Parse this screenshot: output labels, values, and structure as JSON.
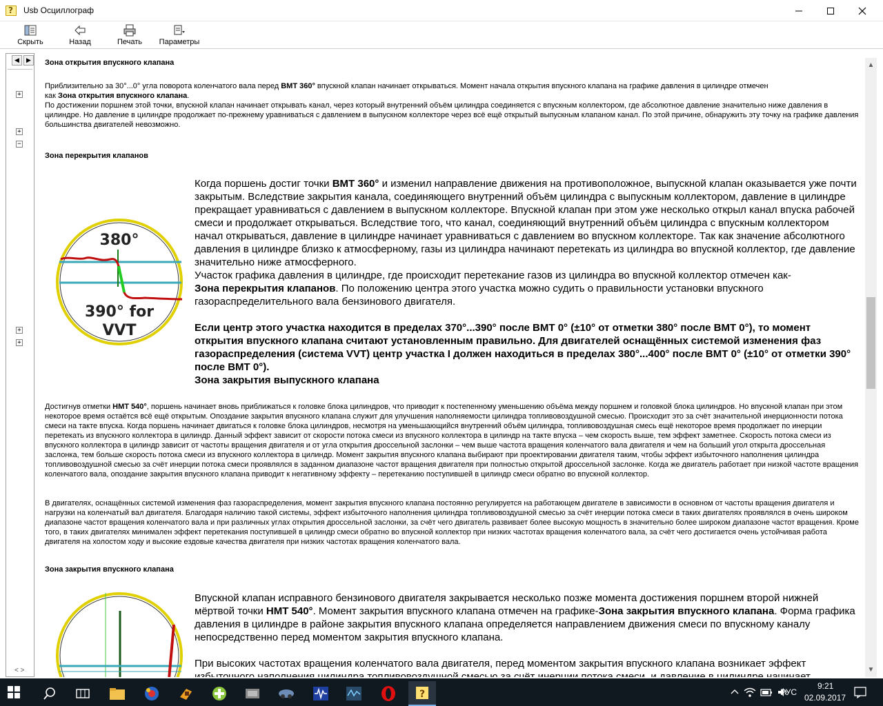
{
  "window": {
    "title": "Usb Осциллограф"
  },
  "toolbar": {
    "hide": "Скрыть",
    "back": "Назад",
    "print": "Печать",
    "options": "Параметры"
  },
  "navpane": {
    "tab_left": "◀",
    "tab_right": "▶",
    "nodes": [
      "+",
      "+",
      "−",
      "+",
      "+"
    ],
    "scroll": "< >"
  },
  "content": {
    "h_intake_open": "Зона открытия впускного клапана",
    "p1_part1": "Приблизительно за 30°...0° угла поворота коленчатого вала перед ",
    "p1_bmt": "BMT 360°",
    "p1_part2": " впускной клапан начинает открываться. Момент начала открытия впускного клапана на графике давления в цилиндре отмечен",
    "p1_as": "как ",
    "p1_zone": "Зона открытия впускного клапана",
    "p1_dot": ".",
    "p1_rest": "По достижении поршнем этой точки, впускной клапан начинает открывать канал, через который внутренний объём цилиндра соединяется с впускным коллектором, где абсолютное давление значительно ниже давления в цилиндре. Но давление в цилиндре продолжает по-прежнему уравниваться с давлением в выпускном коллекторе через всё ещё открытый выпускным клапаном канал. По этой причине, обнаружить эту точку на графике давления большинства двигателей невозможно.",
    "h_overlap": "Зона перекрытия клапанов",
    "fig1_top": "380°",
    "fig1_bottom1": "390° for",
    "fig1_bottom2": "VVT",
    "ov_1": "Когда поршень достиг точки ",
    "ov_bmt": "BMT 360°",
    "ov_2": " и изменил направление движения на противоположное, выпускной клапан оказывается уже почти закрытым. Вследствие закрытия канала, соединяющего внутренний объём цилиндра с выпускным коллектором, давление в цилиндре прекращает уравниваться с давлением в выпускном коллекторе. Впускной клапан при этом уже несколько открыл канал впуска рабочей смеси и продолжает открываться. Вследствие того, что канал, соединяющий внутренний объём цилиндра с впускным коллектором начал открываться, давление в цилиндре начинает уравниваться с давлением во впускном коллекторе. Так как значение абсолютного давления в цилиндре близко к атмосферному, газы из цилиндра начинают перетекать из цилиндра во впускной коллектор, где давление значительно ниже атмосферного.",
    "ov_3": "Участок графика давления в цилиндре, где происходит перетекание газов из цилиндра во впускной коллектор отмечен как-",
    "ov_zone": "Зона перекрытия клапанов",
    "ov_4": ". По положению центра этого участка можно судить о правильности установки впускного газораспределительного вала бензинового двигателя.",
    "ov_bold": "Если центр этого участка находится в пределах 370°...390° после BMT 0° (±10° от отметки 380° после BMT 0°), то момент открытия впускного клапана считают установленным правильно. Для двигателей оснащённых системой изменения фаз газораспределения (система VVT) центр участка I должен находиться в пределах 380°...400° после BMT 0° (±10° от отметки 390° после BMT 0°).",
    "ov_exh": "Зона закрытия выпускного клапана",
    "p2_1": "Достигнув отметки ",
    "p2_nmt": "HMT 540°",
    "p2_2": ", поршень начинает вновь приближаться к головке блока цилиндров, что приводит к постепенному уменьшению объёма между поршнем и головкой блока цилиндров. Но впускной клапан при этом некоторое время остаётся всё ещё открытым. Опоздание закрытия впускного клапана служит для улучшения наполняемости цилиндра топливовоздушной смесью. Происходит это за счёт значительной инерционности потока смеси на такте впуска. Когда поршень начинает двигаться к головке блока цилиндров, несмотря на уменьшающийся внутренний объём цилиндра, топливовоздушная смесь ещё некоторое время продолжает по инерции перетекать из впускного коллектора в цилиндр. Данный эффект зависит от скорости потока смеси из впускного коллектора в цилиндр на такте впуска – чем скорость выше, тем эффект заметнее. Скорость потока смеси из впускного коллектора в цилиндр зависит от частоты вращения двигателя и от угла открытия дроссельной заслонки – чем выше частота вращения коленчатого вала двигателя и чем на больший угол открыта дроссельная заслонка, тем больше скорость потока смеси из впускного коллектора в цилиндр. Момент закрытия впускного клапана выбирают при проектировании двигателя таким, чтобы эффект избыточного наполнения цилиндра топливовоздушной смесью за счёт инерции потока смеси проявлялся в заданном диапазоне частот вращения двигателя при полностью открытой дроссельной заслонке. Когда же двигатель работает при низкой частоте вращения коленчатого вала, опоздание закрытия впускного клапана приводит к негативному эффекту – перетеканию поступившей в цилиндр смеси обратно во впускной коллектор.",
    "p3": "В двигателях, оснащённых системой изменения фаз газораспределения, момент закрытия впускного клапана постоянно регулируется на работающем двигателе в зависимости в основном от частоты вращения двигателя и нагрузки на коленчатый вал двигателя. Благодаря наличию такой системы, эффект избыточного наполнения цилиндра топливовоздушной смесью за счёт инерции потока смеси в таких двигателях проявлялся в очень широком диапазоне частот вращения коленчатого вала и при различных углах открытия дроссельной заслонки, за счёт чего двигатель развивает более высокую мощность в значительно более широком диапазоне частот вращения. Кроме того, в таких двигателях минимален эффект перетекания поступившей в цилиндр смеси обратно во впускной коллектор при низких частотах вращения коленчатого вала, за счёт чего достигается очень устойчивая работа двигателя на холостом ходу и высокие ездовые качества двигателя при низких частотах вращения коленчатого вала.",
    "h_intake_close": "Зона закрытия впускного клапана",
    "ic_1": "  Впускной клапан исправного бензинового двигателя закрывается несколько позже момента достижения поршнем второй нижней мёртвой точки ",
    "ic_nmt": "HMT 540°",
    "ic_2": ". Момент закрытия впускного клапана отмечен на графике-",
    "ic_zone": "Зона закрытия впускного клапана",
    "ic_3": ". Форма графика давления в цилиндре в районе закрытия впускного клапана определяется направлением движения смеси по впускному каналу непосредственно перед моментом закрытия впускного клапана.",
    "ic_4": "При высоких частотах вращения коленчатого вала двигателя, перед моментом закрытия впускного клапана возникает эффект избыточного наполнения цилиндра топливовоздушной смесью за счёт инерции потока смеси, и давление в цилиндре начинает"
  },
  "taskbar": {
    "lang": "РУС",
    "time": "9:21",
    "date": "02.09.2017"
  },
  "colors": {
    "taskbar": "#101820",
    "accent": "#7ab1e6"
  }
}
